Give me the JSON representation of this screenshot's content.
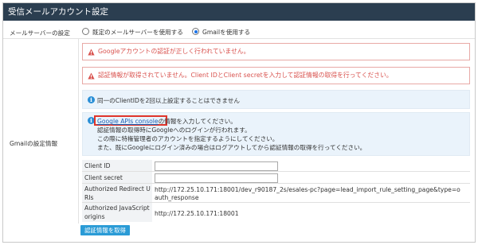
{
  "page": {
    "title": "受信メールアカウント設定"
  },
  "mail_server": {
    "label": "メールサーバーの設定",
    "options": [
      {
        "label": "既定のメールサーバーを使用する",
        "selected": false
      },
      {
        "label": "Gmailを使用する",
        "selected": true
      }
    ]
  },
  "gmail": {
    "label": "Gmailの設定情報",
    "alerts": [
      "Googleアカウントの認証が正しく行われていません。",
      "認証情報が取得されていません。Client IDとClient secretを入力して認証情報の取得を行ってください。"
    ],
    "notice": "同一のClientIDを2回以上設定することはできません",
    "instructions": {
      "link_text": "Google APIs console",
      "line1_suffix": "の情報を入力してください。",
      "line2": "認証情報の取得時にGoogleへのログインが行われます。",
      "line3": "この際に特権管理者のアカウントを指定するようにしてください。",
      "line4": "また、既にGoogleにログイン済みの場合はログアウトしてから認証情報の取得を行ってください。"
    },
    "fields": {
      "client_id": {
        "label": "Client ID",
        "value": ""
      },
      "client_secret": {
        "label": "Client secret",
        "value": ""
      },
      "redirect_uris": {
        "label_line1": "Authorized Redirect U",
        "label_line2": "RIs",
        "value_line1": "http://172.25.10.171:18001/dev_r90187_2s/esales-pc?page=lead_import_rule_setting_page&type=o",
        "value_line2": "auth_response"
      },
      "js_origins": {
        "label_line1": "Authorized JavaScript",
        "label_line2": "origins",
        "value": "http://172.25.10.171:18001"
      }
    },
    "fetch_button": "認証情報を取得"
  },
  "colors": {
    "titlebar": "#2b3e50",
    "alert_text": "#d9534f",
    "info_bg": "#eaf3fb",
    "button": "#2a9bd6",
    "highlight": "#e0352b"
  }
}
